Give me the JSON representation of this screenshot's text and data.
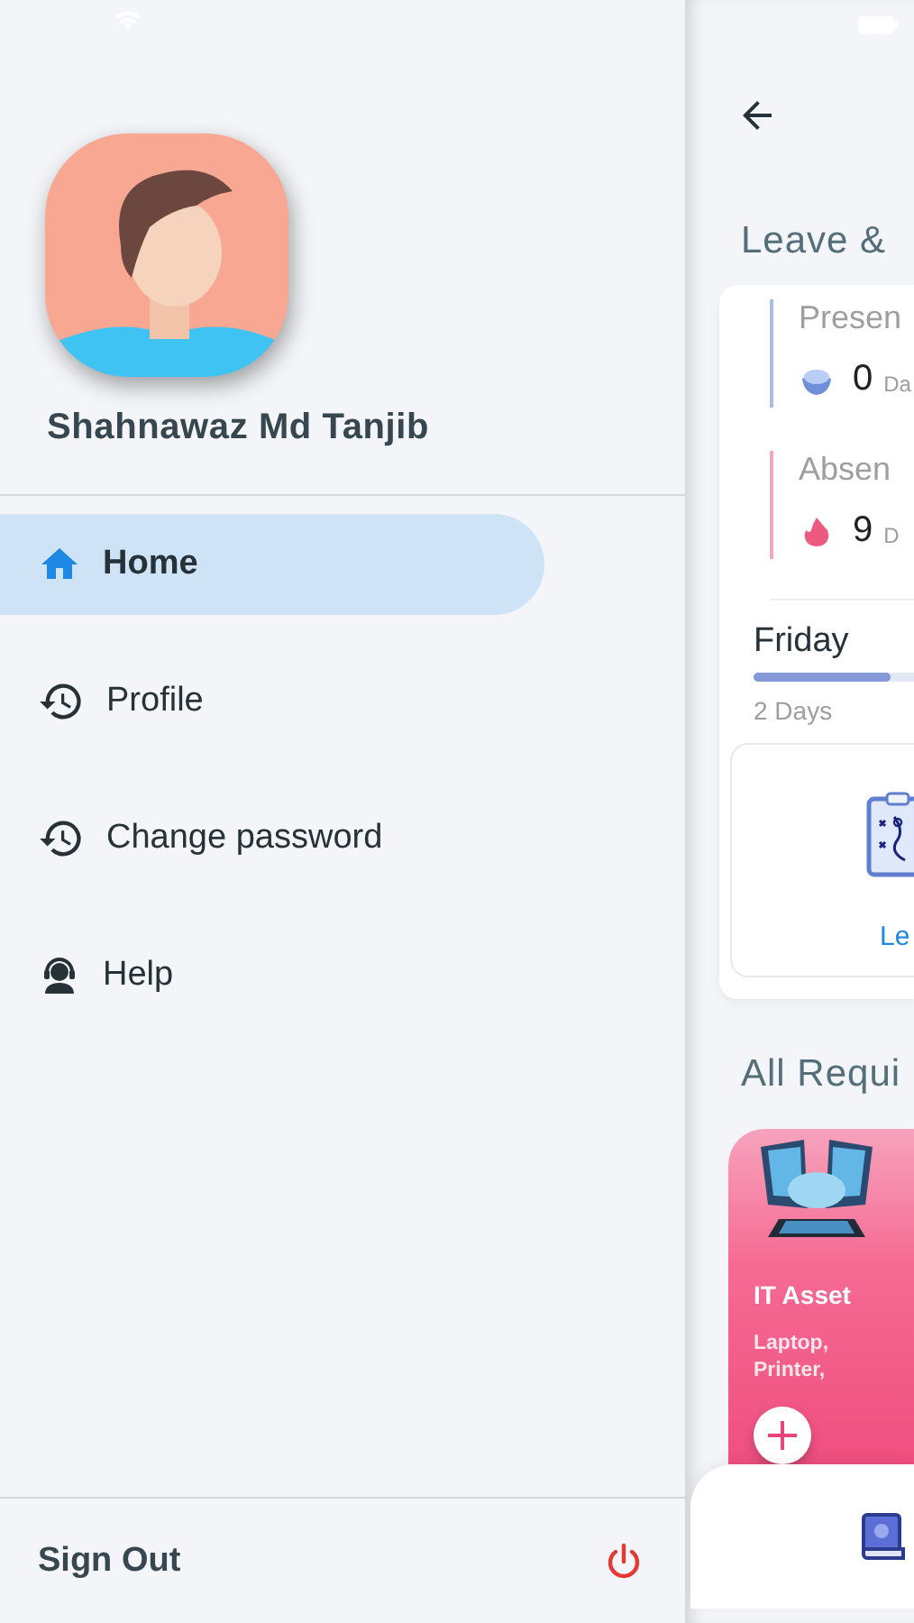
{
  "drawer": {
    "user_name": "Shahnawaz Md Tanjib",
    "menu": [
      {
        "kind": "home",
        "label": "Home",
        "selected": true
      },
      {
        "kind": "history",
        "label": "Profile",
        "selected": false
      },
      {
        "kind": "history",
        "label": "Change password",
        "selected": false
      },
      {
        "kind": "support",
        "label": "Help",
        "selected": false
      }
    ],
    "sign_out": "Sign Out"
  },
  "main": {
    "section_title": "Leave &",
    "stats": [
      {
        "kind": "present",
        "label": "Presen",
        "count": "0",
        "unit": "Da",
        "color": "#aabbe6"
      },
      {
        "kind": "absent",
        "label": "Absen",
        "count": "9",
        "unit": "D",
        "color": "#f3a9bb"
      }
    ],
    "day": {
      "name": "Friday",
      "level": 0.85,
      "caption": "2 Days"
    },
    "leave_action": "Le",
    "requests_title": "All Requi",
    "requests": [
      {
        "title": "IT Asset",
        "description": "Laptop,\nPrinter,"
      }
    ]
  }
}
